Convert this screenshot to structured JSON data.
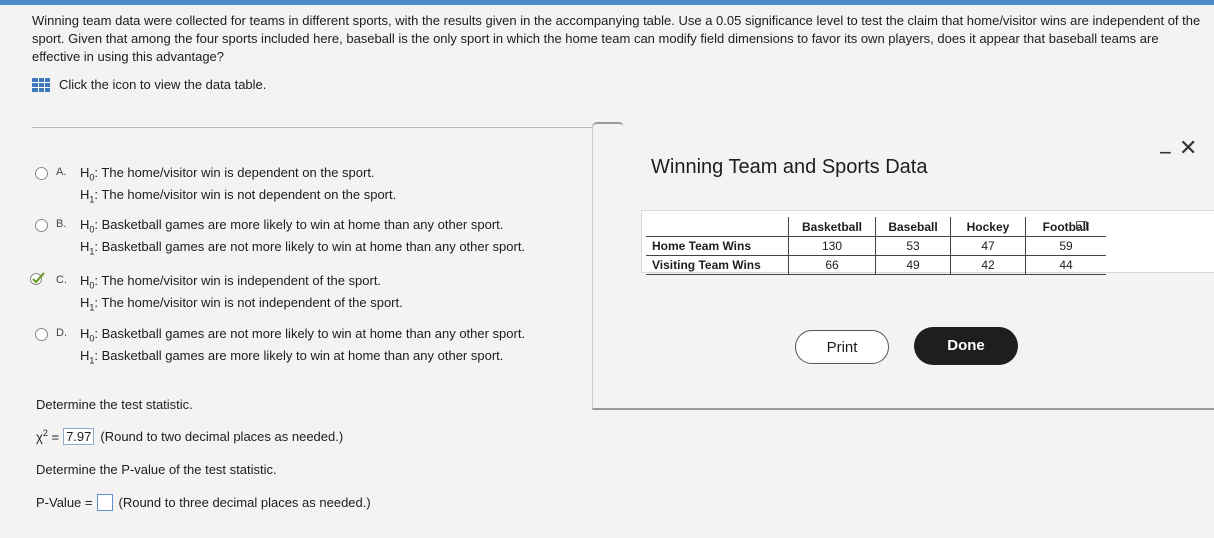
{
  "question": "Winning team data were collected for teams in different sports, with the results given in the accompanying table. Use a 0.05 significance level to test the claim that home/visitor wins are independent of the sport. Given that among the four sports included here, baseball is the only sport in which the home team can modify field dimensions to favor its own players, does it appear that baseball teams are effective in using this advantage?",
  "hint": "Click the icon to view the data table.",
  "h0_symbol": "H",
  "h0_sub": "0",
  "h1_symbol": "H",
  "h1_sub": "1",
  "options": [
    {
      "letter": "A.",
      "h0": ": The home/visitor win is dependent on the sport.",
      "h1": ": The home/visitor win is not dependent on the sport."
    },
    {
      "letter": "B.",
      "h0": ": Basketball games are more likely to win at home than any other sport.",
      "h1": ": Basketball games are not more likely to win at home than any other sport."
    },
    {
      "letter": "C.",
      "h0": ": The home/visitor win is independent of the sport.",
      "h1": ": The home/visitor win is not independent of the sport.",
      "selected": true
    },
    {
      "letter": "D.",
      "h0": ": Basketball games are not more likely to win at home than any other sport.",
      "h1": ": Basketball games are more likely to win at home than any other sport."
    }
  ],
  "stat_label": "Determine the test statistic.",
  "chi_symbol": "χ",
  "chi_power": "2",
  "chi_equals": " =",
  "chi_value": "7.97",
  "chi_note": "(Round to two decimal places as needed.)",
  "pvalue_label": "Determine the P-value of the test statistic.",
  "pvalue_prefix": "P-Value =",
  "pvalue_note": "(Round to three decimal places as needed.)",
  "popup": {
    "title": "Winning Team and Sports Data",
    "minimize": "−",
    "close": "✕",
    "columns": [
      "Basketball",
      "Baseball",
      "Hockey",
      "Football"
    ],
    "rows": [
      {
        "label": "Home Team Wins",
        "values": [
          "130",
          "53",
          "47",
          "59"
        ]
      },
      {
        "label": "Visiting Team Wins",
        "values": [
          "66",
          "49",
          "42",
          "44"
        ]
      }
    ],
    "print_label": "Print",
    "done_label": "Done"
  },
  "colors": {
    "accent": "#4a8bc8",
    "icon": "#3f78bf",
    "done_bg": "#1e1e1e"
  }
}
